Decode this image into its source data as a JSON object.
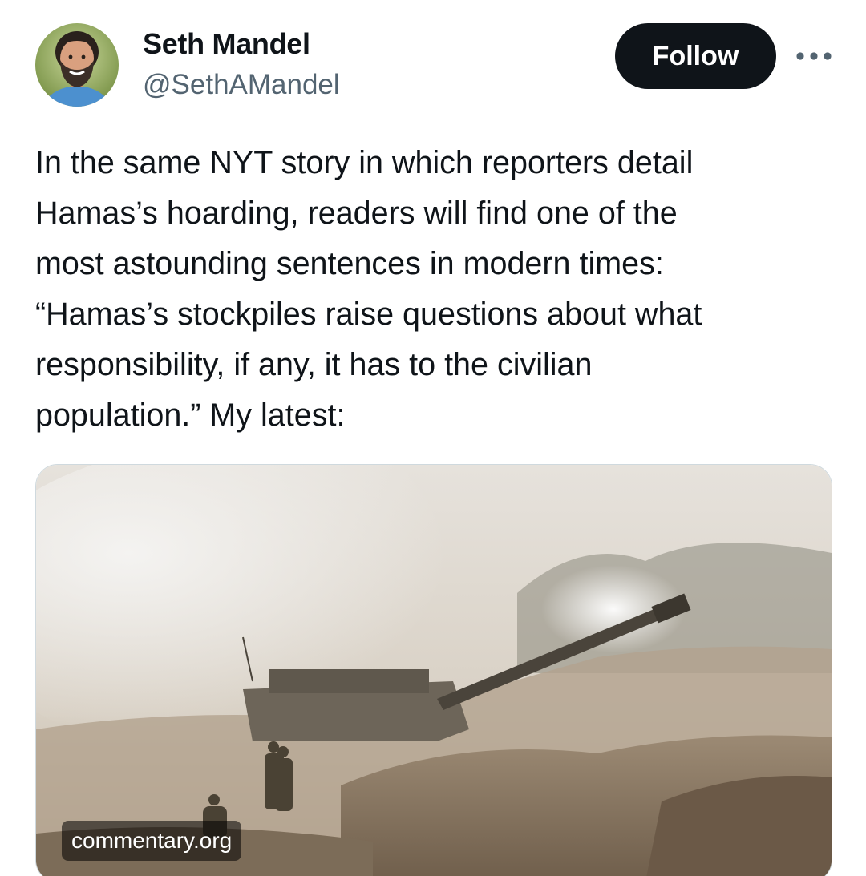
{
  "author": {
    "display_name": "Seth Mandel",
    "handle": "@SethAMandel"
  },
  "actions": {
    "follow_label": "Follow",
    "more_icon": "more-horizontal-icon"
  },
  "tweet": {
    "text_lines": [
      "In the same NYT story in which reporters detail",
      "Hamas’s hoarding, readers will find one of the",
      "most astounding sentences in modern times:",
      "“Hamas’s stockpiles raise questions about what",
      "responsibility, if any, it has to the civilian",
      "population.” My latest:"
    ]
  },
  "link_card": {
    "domain": "commentary.org",
    "image_description_icon": "artillery-photo"
  },
  "colors": {
    "text_primary": "#0f1419",
    "text_secondary": "#536471",
    "follow_bg": "#0f1419",
    "border": "#cfd9de"
  }
}
